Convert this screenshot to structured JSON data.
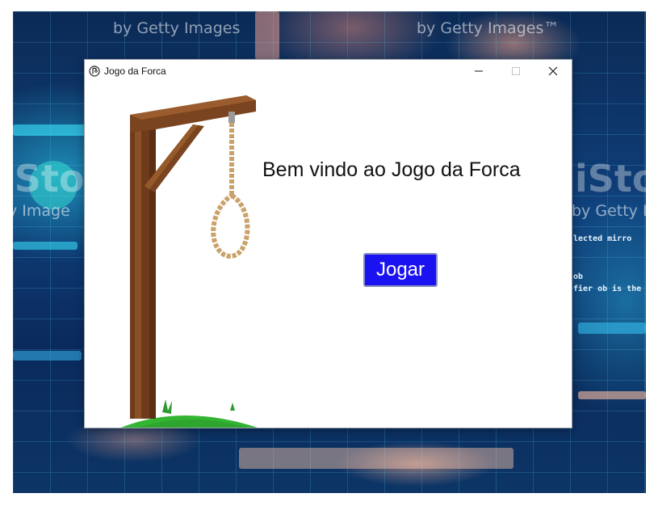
{
  "window": {
    "title": "Jogo da Forca",
    "controls": {
      "minimize": "−",
      "maximize": "☐",
      "close": "✕"
    }
  },
  "main": {
    "welcome_text": "Bem vindo ao Jogo da Forca",
    "play_label": "Jogar"
  },
  "background": {
    "watermark_lines": [
      "by Getty Images",
      "by Getty Images™",
      "iStock",
      "iStock",
      "y Image",
      "by Getty I"
    ],
    "code_lines": [
      "lected mirro",
      "ob",
      "fier ob is the"
    ]
  },
  "colors": {
    "play_button": "#1a12f0",
    "wood": "#7a4420",
    "rope": "#c9a26a",
    "grass": "#33b533"
  },
  "icons": {
    "app": "hangman-app-icon"
  }
}
